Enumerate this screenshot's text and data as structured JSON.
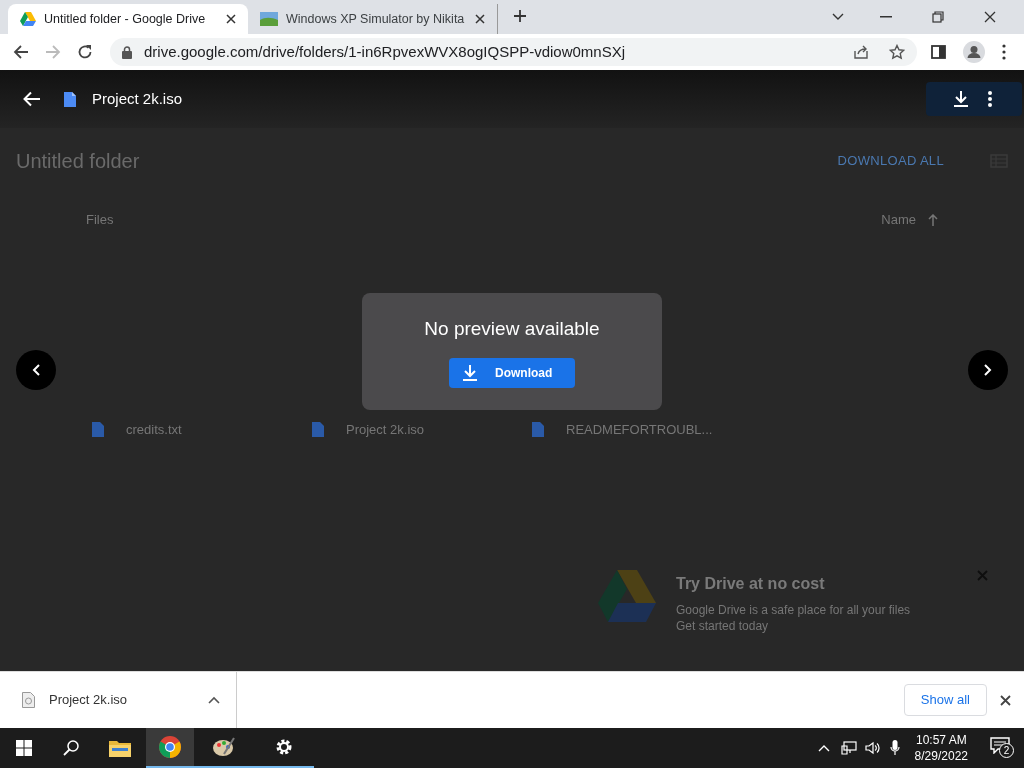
{
  "browser": {
    "tabs": [
      {
        "title": "Untitled folder - Google Drive",
        "selected": true
      },
      {
        "title": "Windows XP Simulator by Nikita",
        "selected": false
      }
    ],
    "url": "drive.google.com/drive/folders/1-in6RpvexWVX8ogIQSPP-vdiow0mnSXj"
  },
  "viewer": {
    "file_name": "Project 2k.iso",
    "message": "No preview available",
    "download_button": "Download"
  },
  "folder": {
    "title": "Untitled folder",
    "download_all": "DOWNLOAD ALL",
    "files_heading": "Files",
    "sort_label": "Name",
    "files": [
      "credits.txt",
      "Project 2k.iso",
      "READMEFORTROUBL..."
    ],
    "promo": {
      "title": "Try Drive at no cost",
      "lines": [
        "Google Drive is a safe place for all your files",
        "Get started today"
      ]
    }
  },
  "download_shelf": {
    "file": "Project 2k.iso",
    "show_all": "Show all"
  },
  "taskbar": {
    "time": "10:57 AM",
    "date": "8/29/2022",
    "notifications": "2"
  }
}
